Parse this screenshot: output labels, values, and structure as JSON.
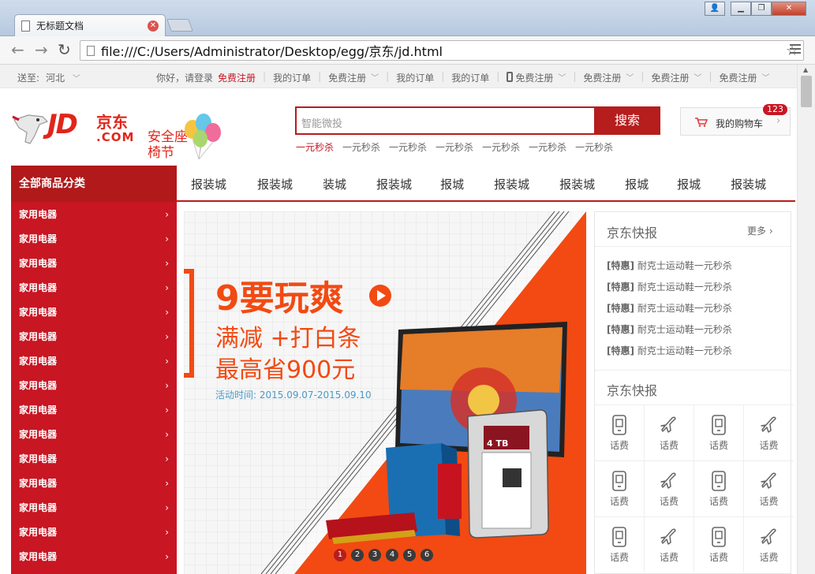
{
  "browser": {
    "tab_title": "无标题文档",
    "url": "file:///C:/Users/Administrator/Desktop/egg/京东/jd.html"
  },
  "shortcut": {
    "ship_to": "送至:",
    "city": "河北",
    "greeting": "你好，请登录",
    "register": "免费注册",
    "links": [
      {
        "label": "我的订单",
        "dropdown": false
      },
      {
        "label": "免费注册",
        "dropdown": true
      },
      {
        "label": "我的订单",
        "dropdown": false
      },
      {
        "label": "我的订单",
        "dropdown": false
      },
      {
        "label": "免费注册",
        "dropdown": true,
        "icon": "phone-icon"
      },
      {
        "label": "免费注册",
        "dropdown": true
      },
      {
        "label": "免费注册",
        "dropdown": true
      },
      {
        "label": "免费注册",
        "dropdown": true
      }
    ]
  },
  "header": {
    "logo_text": "JD",
    "logo_cn": "京东",
    "logo_com": ".COM",
    "promo": "安全座椅节",
    "search_placeholder": "智能微投",
    "search_button": "搜索",
    "hotwords": [
      "一元秒杀",
      "一元秒杀",
      "一元秒杀",
      "一元秒杀",
      "一元秒杀",
      "一元秒杀",
      "一元秒杀"
    ],
    "cart_label": "我的购物车",
    "cart_count": "123"
  },
  "nav": {
    "all_categories": "全部商品分类",
    "items": [
      "报装城",
      "报装城",
      "装城",
      "报装城",
      "报城",
      "报装城",
      "报装城",
      "报城",
      "报城",
      "报装城"
    ]
  },
  "categories": [
    "家用电器",
    "家用电器",
    "家用电器",
    "家用电器",
    "家用电器",
    "家用电器",
    "家用电器",
    "家用电器",
    "家用电器",
    "家用电器",
    "家用电器",
    "家用电器",
    "家用电器",
    "家用电器",
    "家用电器"
  ],
  "banner": {
    "headline": "9要玩爽",
    "line2": "满减 +打白条",
    "line3": "最高省900元",
    "date": "活动时间: 2015.09.07-2015.09.10",
    "slides": [
      "1",
      "2",
      "3",
      "4",
      "5",
      "6"
    ],
    "active_slide": 1,
    "hdd_capacity": "4 TB"
  },
  "news": {
    "title": "京东快报",
    "more": "更多",
    "items": [
      {
        "tag": "[特惠]",
        "text": "耐克士运动鞋一元秒杀"
      },
      {
        "tag": "[特惠]",
        "text": "耐克士运动鞋一元秒杀"
      },
      {
        "tag": "[特惠]",
        "text": "耐克士运动鞋一元秒杀"
      },
      {
        "tag": "[特惠]",
        "text": "耐克士运动鞋一元秒杀"
      },
      {
        "tag": "[特惠]",
        "text": "耐克士运动鞋一元秒杀"
      }
    ],
    "services_title": "京东快报",
    "services": [
      {
        "label": "话费",
        "icon": "phone-bill-icon"
      },
      {
        "label": "话费",
        "icon": "plane-icon"
      },
      {
        "label": "话费",
        "icon": "phone-bill-icon"
      },
      {
        "label": "话费",
        "icon": "plane-icon"
      },
      {
        "label": "话费",
        "icon": "phone-bill-icon"
      },
      {
        "label": "话费",
        "icon": "plane-icon"
      },
      {
        "label": "话费",
        "icon": "phone-bill-icon"
      },
      {
        "label": "话费",
        "icon": "plane-icon"
      },
      {
        "label": "话费",
        "icon": "phone-bill-icon"
      },
      {
        "label": "话费",
        "icon": "plane-icon"
      },
      {
        "label": "话费",
        "icon": "phone-bill-icon"
      },
      {
        "label": "话费",
        "icon": "plane-icon"
      }
    ]
  },
  "colors": {
    "brand_red": "#c81623",
    "dark_red": "#b61d1d",
    "banner_orange": "#f24a12"
  }
}
